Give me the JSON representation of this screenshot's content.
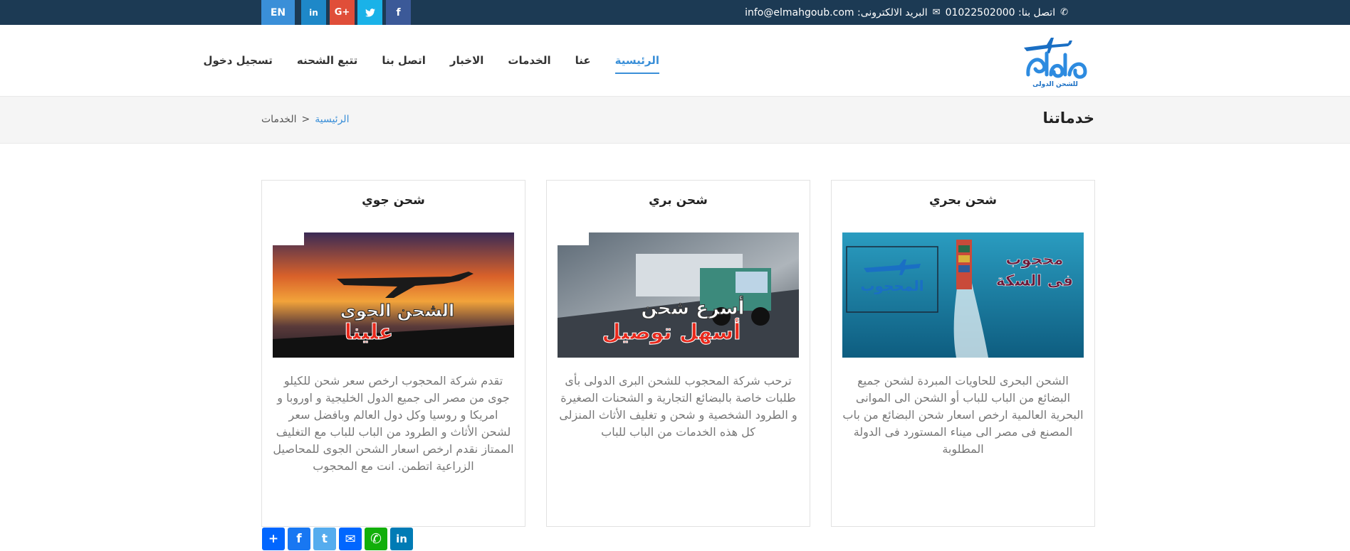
{
  "topbar": {
    "lang_button": "EN",
    "social": {
      "linkedin": "in",
      "google_plus": "G+",
      "twitter": "t",
      "facebook": "f"
    },
    "phone_label": "اتصل بنا: 01022502000",
    "email_label": "البريد الالكترونى: info@elmahgoub.com"
  },
  "nav": {
    "logo_text": "المحجوب",
    "logo_sub": "للشحن الدولى",
    "items": [
      "الرئيسية",
      "عنا",
      "الخدمات",
      "الاخبار",
      "اتصل بنا",
      "تتبع الشحنه",
      "تسجيل دخول"
    ]
  },
  "pagehead": {
    "title": "خدماتنا",
    "crumb_home": "الرئيسية",
    "crumb_sep": ">",
    "crumb_current": "الخدمات"
  },
  "cards": [
    {
      "title": "شحن بحري",
      "image_caption_1": "محجوب",
      "image_caption_2": "فى السكة",
      "text": "الشحن البحرى للحاويات المبردة لشحن جميع البضائع من الباب للباب أو الشحن الى الموانى البحرية العالمية ارخص اسعار شحن البضائع من باب المصنع فى مصر الى ميناء المستورد فى الدولة المطلوبة"
    },
    {
      "title": "شحن بري",
      "image_caption_1": "أسرع شحن",
      "image_caption_2": "أسهل توصيل",
      "text": "ترحب شركة المحجوب للشحن البرى الدولى بأى طلبات خاصة بالبضائع التجارية و الشحنات الصغيرة و الطرود الشخصية و شحن و تغليف الأثاث المنزلى كل هذه الخدمات من الباب للباب"
    },
    {
      "title": "شحن جوي",
      "image_caption_1": "الشحن الجوى",
      "image_caption_2": "علينا",
      "text": "تقدم شركة المحجوب ارخص سعر شحن للكيلو جوى من مصر الى جميع الدول الخليجية و اوروبا و امريكا و روسيا وكل دول العالم وبافضل سعر لشحن الأثاث و الطرود من الباب للباب مع التغليف الممتاز نقدم ارخص اسعار الشحن الجوى للمحاصيل الزراعية اتطمن. انت مع المحجوب"
    }
  ],
  "share": {
    "add": "+",
    "facebook": "f",
    "twitter": "t",
    "email": "✉",
    "whatsapp": "✆",
    "linkedin": "in"
  }
}
